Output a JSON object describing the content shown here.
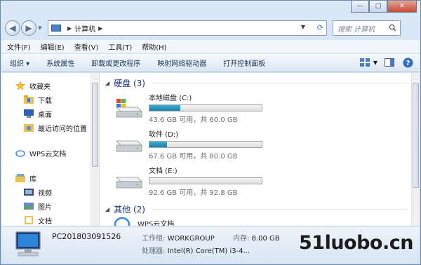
{
  "window": {
    "caption_minimize": "—",
    "caption_maximize": "□",
    "caption_close": "✕"
  },
  "address": {
    "location": "计算机",
    "search_placeholder": "搜索 计算机"
  },
  "menu": [
    "文件(F)",
    "编辑(E)",
    "查看(V)",
    "工具(T)",
    "帮助(H)"
  ],
  "toolbar": {
    "items": [
      "组织 ▾",
      "系统属性",
      "卸载或更改程序",
      "映射网络驱动器",
      "打开控制面板"
    ]
  },
  "nav": {
    "favorites": "收藏夹",
    "downloads": "下载",
    "desktop": "桌面",
    "recent": "最近访问的位置",
    "wps": "WPS云文档",
    "libraries": "库",
    "videos": "视频",
    "pictures": "图片",
    "documents": "文档"
  },
  "groups": {
    "hard_drives": "硬盘 (3)",
    "other": "其他 (2)"
  },
  "drives": [
    {
      "name": "本地磁盘 (C:)",
      "free": "43.6 GB 可用，共 60.0 GB",
      "used_fraction": 0.273
    },
    {
      "name": "软件 (D:)",
      "free": "67.6 GB 可用，共 80.0 GB",
      "used_fraction": 0.155
    },
    {
      "name": "文档 (E:)",
      "free": "92.6 GB 可用，共 92.8 GB",
      "used_fraction": 0.002
    }
  ],
  "other_items": {
    "wps_cloud": "WPS云文档"
  },
  "details": {
    "computer_name": "PC201803091526",
    "workgroup_label": "工作组:",
    "workgroup_value": "WORKGROUP",
    "memory_label": "内存:",
    "memory_value": "8.00 GB",
    "cpu_label": "处理器:",
    "cpu_value": "Intel(R) Core(TM) i3-4..."
  },
  "watermark": "51luobo.cn",
  "colors": {
    "accent": "#1e3287",
    "drive_fill": "#1d7ea8"
  },
  "icons": [
    "back-icon",
    "forward-icon",
    "computer-icon",
    "refresh-icon",
    "search-icon",
    "star-icon",
    "folder-icon",
    "desktop-icon",
    "recent-icon",
    "cloud-icon",
    "library-icon",
    "video-icon",
    "picture-icon",
    "document-icon",
    "drive-icon",
    "view-icon",
    "preview-pane-icon",
    "help-icon"
  ]
}
